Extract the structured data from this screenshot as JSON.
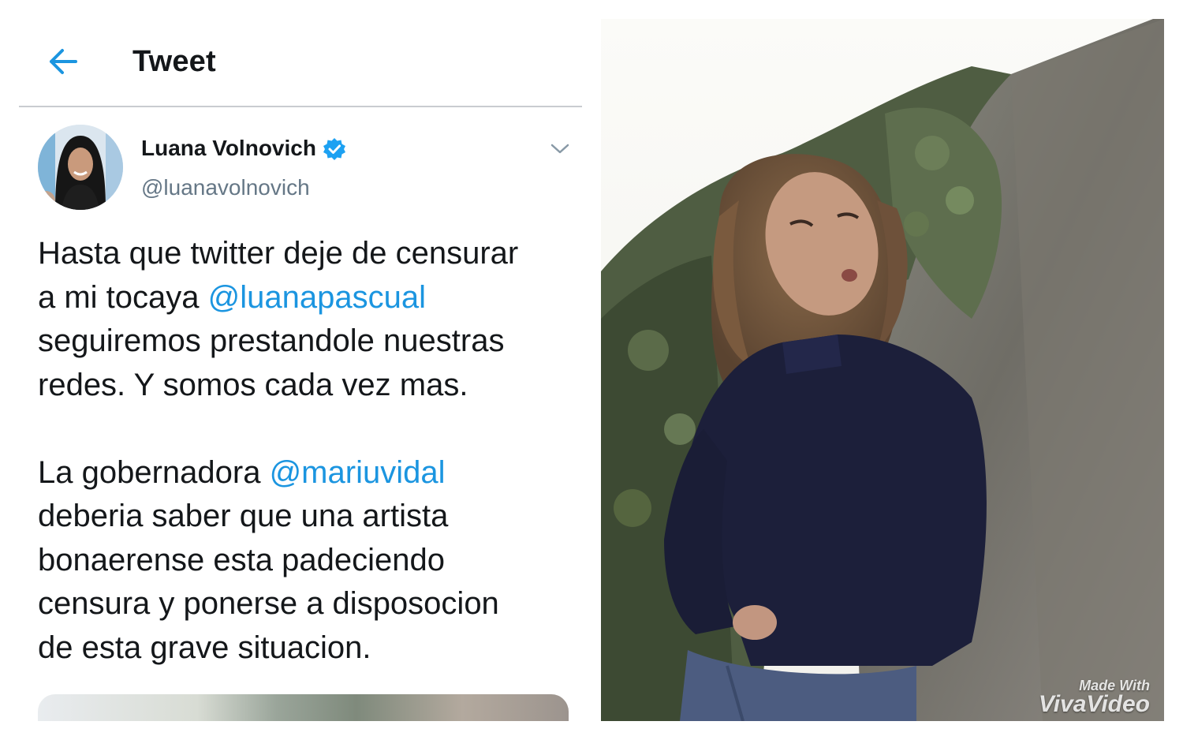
{
  "header": {
    "back_icon": "arrow-left-icon",
    "title": "Tweet"
  },
  "tweet": {
    "author": {
      "name": "Luana Volnovich",
      "handle": "@luanavolnovich",
      "verified": true,
      "verified_icon": "verified-badge-icon"
    },
    "menu_icon": "chevron-down-icon",
    "paragraph1": {
      "line1": "Hasta que twitter deje de censurar",
      "line2_prefix": "a mi tocaya ",
      "mention1": "@luanapascual",
      "line3": "seguiremos prestandole nuestras",
      "line4": "redes. Y somos cada vez mas."
    },
    "paragraph2": {
      "line1_prefix": "La gobernadora ",
      "mention2": "@mariuvidal",
      "line2": "deberia saber que una artista",
      "line3": "bonaerense esta padeciendo",
      "line4": "censura y ponerse a disposocion",
      "line5": "de esta grave situacion."
    }
  },
  "photo": {
    "watermark_line1": "Made With",
    "watermark_line2": "VivaVideo"
  },
  "colors": {
    "accent": "#1b95e0",
    "text": "#14171a",
    "secondary": "#657786"
  }
}
